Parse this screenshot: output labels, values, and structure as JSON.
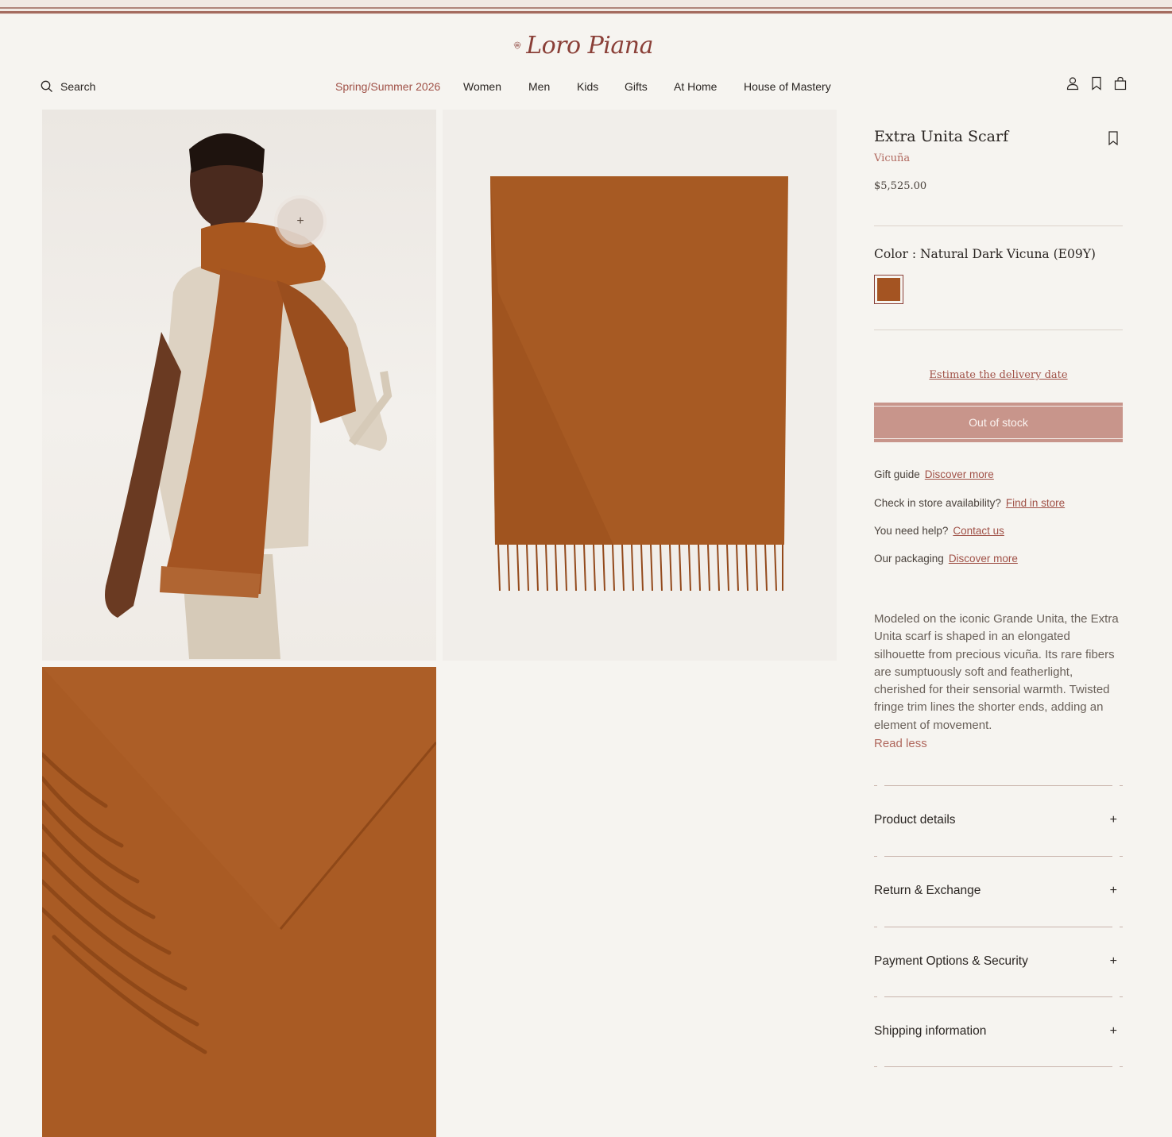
{
  "brand": {
    "name": "Loro Piana"
  },
  "header": {
    "search_label": "Search",
    "nav": [
      "Spring/Summer 2026",
      "Women",
      "Men",
      "Kids",
      "Gifts",
      "At Home",
      "House of Mastery"
    ]
  },
  "gallery": {
    "zoom_button": "+"
  },
  "product": {
    "title": "Extra Unita Scarf",
    "material": "Vicuña",
    "price": "$5,525.00",
    "color_label": "Color : Natural Dark Vicuna (E09Y)",
    "swatch_color": "#a45422",
    "estimate_link": "Estimate the delivery date",
    "cta": "Out of stock",
    "links": [
      {
        "label": "Gift guide",
        "link": "Discover more"
      },
      {
        "label": "Check in store availability?",
        "link": "Find in store"
      },
      {
        "label": "You need help?",
        "link": "Contact us"
      },
      {
        "label": "Our packaging",
        "link": "Discover more"
      }
    ],
    "description": "Modeled on the iconic Grande Unita, the Extra Unita scarf is shaped in an elongated silhouette from precious vicuña. Its rare fibers are sumptuously soft and featherlight, cherished for their sensorial warmth. Twisted fringe trim lines the shorter ends, adding an element of movement.",
    "read_less": "Read less",
    "accordions": [
      "Product details",
      "Return & Exchange",
      "Payment Options & Security",
      "Shipping information"
    ],
    "accordion_toggle": "+"
  },
  "colors": {
    "accent": "#a05147",
    "button": "#c8958b",
    "background": "#f6f4f0"
  }
}
